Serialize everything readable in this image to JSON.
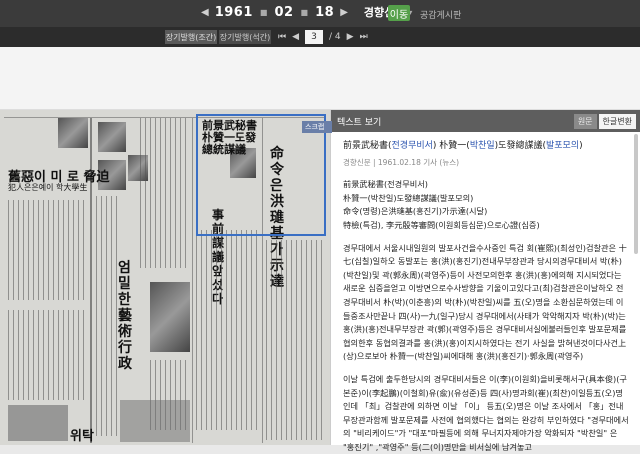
{
  "topbar": {
    "year": "1961",
    "month": "02",
    "day": "18",
    "paper": "경향신문",
    "go_label": "이동",
    "notice_label": "공감게시판"
  },
  "subbar": {
    "tab1": "장기발행(조간)",
    "tab2": "장기발행(석간)",
    "page_current": "3",
    "page_total": "/ 4"
  },
  "newspaper": {
    "heads": [
      "舊惡이 미 로 脅迫",
      "犯人은은예이 학大學生",
      "前景武秘書 朴贊一도發 總統謀議",
      "命令은洪璡基가示達",
      "事前謀議앞 섰다",
      "엄밀한 藝術行政",
      "위탁"
    ]
  },
  "panel": {
    "header": "텍스트 보기",
    "btn_orig": "원문",
    "btn_han": "한글변환",
    "side_tab": "스크랩",
    "title_a": "前景武秘書(",
    "title_b": "전경무비서",
    "title_c": ") 朴贊一(",
    "title_d": "박찬일",
    "title_e": ")도發總謀議(",
    "title_f": "발포모의",
    "title_g": ")",
    "meta": "경향신문 | 1961.02.18 기사 (뉴스)",
    "sub1": "前景武秘書(전경무비서)",
    "sub2": "朴贊一(박찬일)도發總謀議(발포모의)",
    "sub3": "命令(명령)은洪璡基(홍진기)가示達(시달)",
    "sub4": "特檢(특검), 李元殷等審問(이원회등심문)으로心證(심증)",
    "para1": "경무대에서 서울시내일원의 발포사건을수사중인 특검 회(崔熙)(최성인)검찰관은 十七(십칠)일하오 동발포는 홍(洪)(홍진기)전내무부장관과 당시의경무대비서 박(朴)(박찬일)및 곽(郭永周)(곽영주)등이 사전모의한후 홍(洪)(홍)에의해 지시되었다는 새로운 심증을얻고 이방면으로수사방향을 기울이고있다고(최)검찰관은이날하오 전경무대비서 朴(박)(이춘흥)의 박(朴)(박찬일)씨를 五(오)명을 소환심문하였는데 이들중조사만끝나 四(사)一九(일구)당시 경무대에서(사태가 악악해지자 박(朴)(박)는 홍(洪)(홍)전내무부장관 곽(郭)(곽영주)등은 경무대비서실에불러들인후 발포문제를 협의한후 동협의결과를 홍(洪)(홍)이지시하였다는 전기 사실을 밝혀낸것이다사건上(상)으로보아 朴贊一(박찬일)씨에대해 홍(洪)(홍진기)·郭永周(곽영주)",
    "para2": "이날 특검에 출두한당시의 경무대비서들은 이(李)(이원회)을비롯해서구(具本俊)(구본준)이(李起鵬)(이철회)유(兪)(유성준)등 四(사)명과회(崔)(최찬)이일등五(오)명인데 「최」검찰관에 의하면 이날 「이」 등五(오)명은 이날 조사에서 「홍」전내무장관과함께 발포문제를 사전에 협의했다는 협의는 완강히 부인하였다 \"경무대에서의 \"비리케이드\"가 \"대포\"마필등에 의해 무너지자제야가장 악화되자 \"박찬일\" 은 \"홍진기\" ,\"곽영주\" 등(二(이)명만을 비서실에 남겨놓고"
  }
}
